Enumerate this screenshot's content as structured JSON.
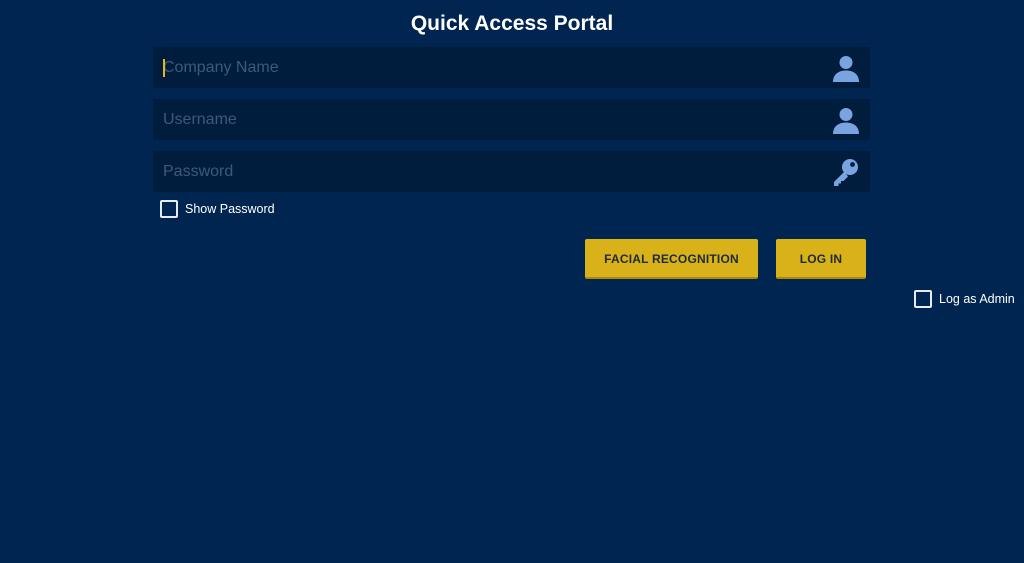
{
  "header": {
    "title": "Quick Access Portal"
  },
  "form": {
    "company": {
      "value": "",
      "placeholder": "Company Name",
      "icon": "user-icon"
    },
    "username": {
      "value": "",
      "placeholder": "Username",
      "icon": "user-icon"
    },
    "password": {
      "value": "",
      "placeholder": "Password",
      "icon": "key-icon"
    },
    "show_password": {
      "label": "Show Password",
      "checked": false
    },
    "facial_recognition_label": "FACIAL RECOGNITION",
    "login_label": "LOG IN",
    "log_as_admin": {
      "label": "Log as Admin",
      "checked": false
    }
  },
  "colors": {
    "background": "#002550",
    "field_background": "#001d3d",
    "placeholder": "#3c5a7e",
    "icon": "#7aa4e0",
    "button": "#d9b21a",
    "button_text": "#1d2a3a",
    "caret": "#e6b81c"
  }
}
